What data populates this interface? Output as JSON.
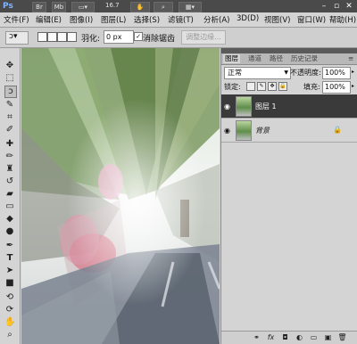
{
  "app": {
    "logo": "Ps",
    "zoom": "16.7",
    "bridge_label": "Br",
    "minibridge_label": "Mb"
  },
  "menu": [
    {
      "label": "文件(F)"
    },
    {
      "label": "编辑(E)"
    },
    {
      "label": "图像(I)"
    },
    {
      "label": "图层(L)"
    },
    {
      "label": "选择(S)"
    },
    {
      "label": "滤镜(T)"
    },
    {
      "label": "分析(A)"
    },
    {
      "label": "3D(D)"
    },
    {
      "label": "视图(V)"
    },
    {
      "label": "窗口(W)"
    },
    {
      "label": "帮助(H)"
    }
  ],
  "options": {
    "feather_label": "羽化:",
    "feather_value": "0 px",
    "anti_alias_checked": "✓",
    "anti_alias_label": "消除锯齿",
    "refine_edge_label": "调整边缘..."
  },
  "tools": [
    {
      "name": "move-tool",
      "glyph": "✥"
    },
    {
      "name": "marquee-tool",
      "glyph": "⬚"
    },
    {
      "name": "lasso-tool",
      "glyph": "ↄ"
    },
    {
      "name": "quick-select-tool",
      "glyph": "✎"
    },
    {
      "name": "crop-tool",
      "glyph": "⌗"
    },
    {
      "name": "eyedropper-tool",
      "glyph": "✐"
    },
    {
      "name": "healing-brush-tool",
      "glyph": "✚"
    },
    {
      "name": "brush-tool",
      "glyph": "✏"
    },
    {
      "name": "clone-stamp-tool",
      "glyph": "♜"
    },
    {
      "name": "history-brush-tool",
      "glyph": "↺"
    },
    {
      "name": "eraser-tool",
      "glyph": "▰"
    },
    {
      "name": "gradient-tool",
      "glyph": "▭"
    },
    {
      "name": "blur-tool",
      "glyph": "◆"
    },
    {
      "name": "dodge-tool",
      "glyph": "●"
    },
    {
      "name": "pen-tool",
      "glyph": "✒"
    },
    {
      "name": "type-tool",
      "glyph": "T"
    },
    {
      "name": "path-select-tool",
      "glyph": "➤"
    },
    {
      "name": "shape-tool",
      "glyph": "■"
    },
    {
      "name": "3d-rotate-tool",
      "glyph": "⟲"
    },
    {
      "name": "3d-camera-tool",
      "glyph": "⟳"
    },
    {
      "name": "hand-tool",
      "glyph": "✋"
    },
    {
      "name": "zoom-tool",
      "glyph": "⌕"
    }
  ],
  "layers_panel": {
    "tabs": [
      {
        "label": "图层",
        "active": true
      },
      {
        "label": "通道",
        "active": false
      },
      {
        "label": "路径",
        "active": false
      },
      {
        "label": "历史记录",
        "active": false
      }
    ],
    "blend_mode": "正常",
    "opacity_label": "不透明度:",
    "opacity_value": "100%",
    "lock_label": "锁定:",
    "fill_label": "填充:",
    "fill_value": "100%",
    "layers": [
      {
        "name": "图层 1",
        "selected": true,
        "locked": false
      },
      {
        "name": "背景",
        "selected": false,
        "locked": true
      }
    ],
    "footer_icons": [
      "link-icon",
      "fx-icon",
      "mask-icon",
      "adjustment-icon",
      "folder-icon",
      "new-layer-icon",
      "trash-icon"
    ]
  },
  "colors": {
    "menu_bg": "#d4d4d4",
    "selected_layer_bg": "#3a3a3a",
    "appbar_bg": "#4a4a4a"
  }
}
